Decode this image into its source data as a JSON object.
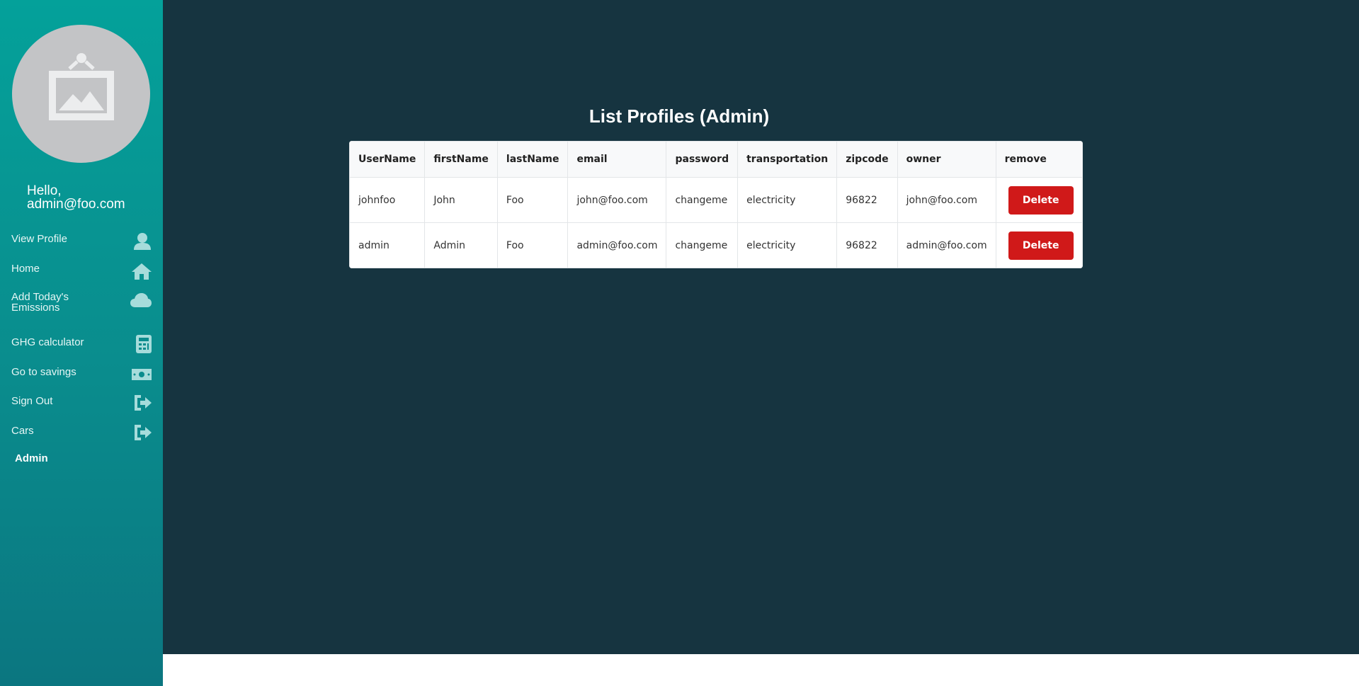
{
  "sidebar": {
    "greeting": "Hello,",
    "user_email": "admin@foo.com",
    "items": [
      {
        "label": "View Profile",
        "icon": "user-icon"
      },
      {
        "label": "Home",
        "icon": "home-icon"
      },
      {
        "label": "Add Today's",
        "label2": "Emissions",
        "icon": "cloud-icon"
      },
      {
        "label": "GHG calculator",
        "icon": "calculator-icon"
      },
      {
        "label": "Go to savings",
        "icon": "money-bill-icon"
      },
      {
        "label": "Sign Out",
        "icon": "sign-out-icon"
      },
      {
        "label": "Cars",
        "icon": "sign-out-icon"
      }
    ],
    "admin_label": "Admin"
  },
  "main": {
    "title": "List Profiles (Admin)",
    "table": {
      "columns": [
        "UserName",
        "firstName",
        "lastName",
        "email",
        "password",
        "transportation",
        "zipcode",
        "owner",
        "remove"
      ],
      "rows": [
        {
          "username": "johnfoo",
          "first": "John",
          "last": "Foo",
          "email": "john@foo.com",
          "password": "changeme",
          "transportation": "electricity",
          "zipcode": "96822",
          "owner": "john@foo.com",
          "action": "Delete"
        },
        {
          "username": "admin",
          "first": "Admin",
          "last": "Foo",
          "email": "admin@foo.com",
          "password": "changeme",
          "transportation": "electricity",
          "zipcode": "96822",
          "owner": "admin@foo.com",
          "action": "Delete"
        }
      ]
    }
  },
  "colors": {
    "sidebar_top": "#04a19a",
    "sidebar_bottom": "#0b7680",
    "main_bg": "#163440",
    "delete": "#d01919"
  }
}
